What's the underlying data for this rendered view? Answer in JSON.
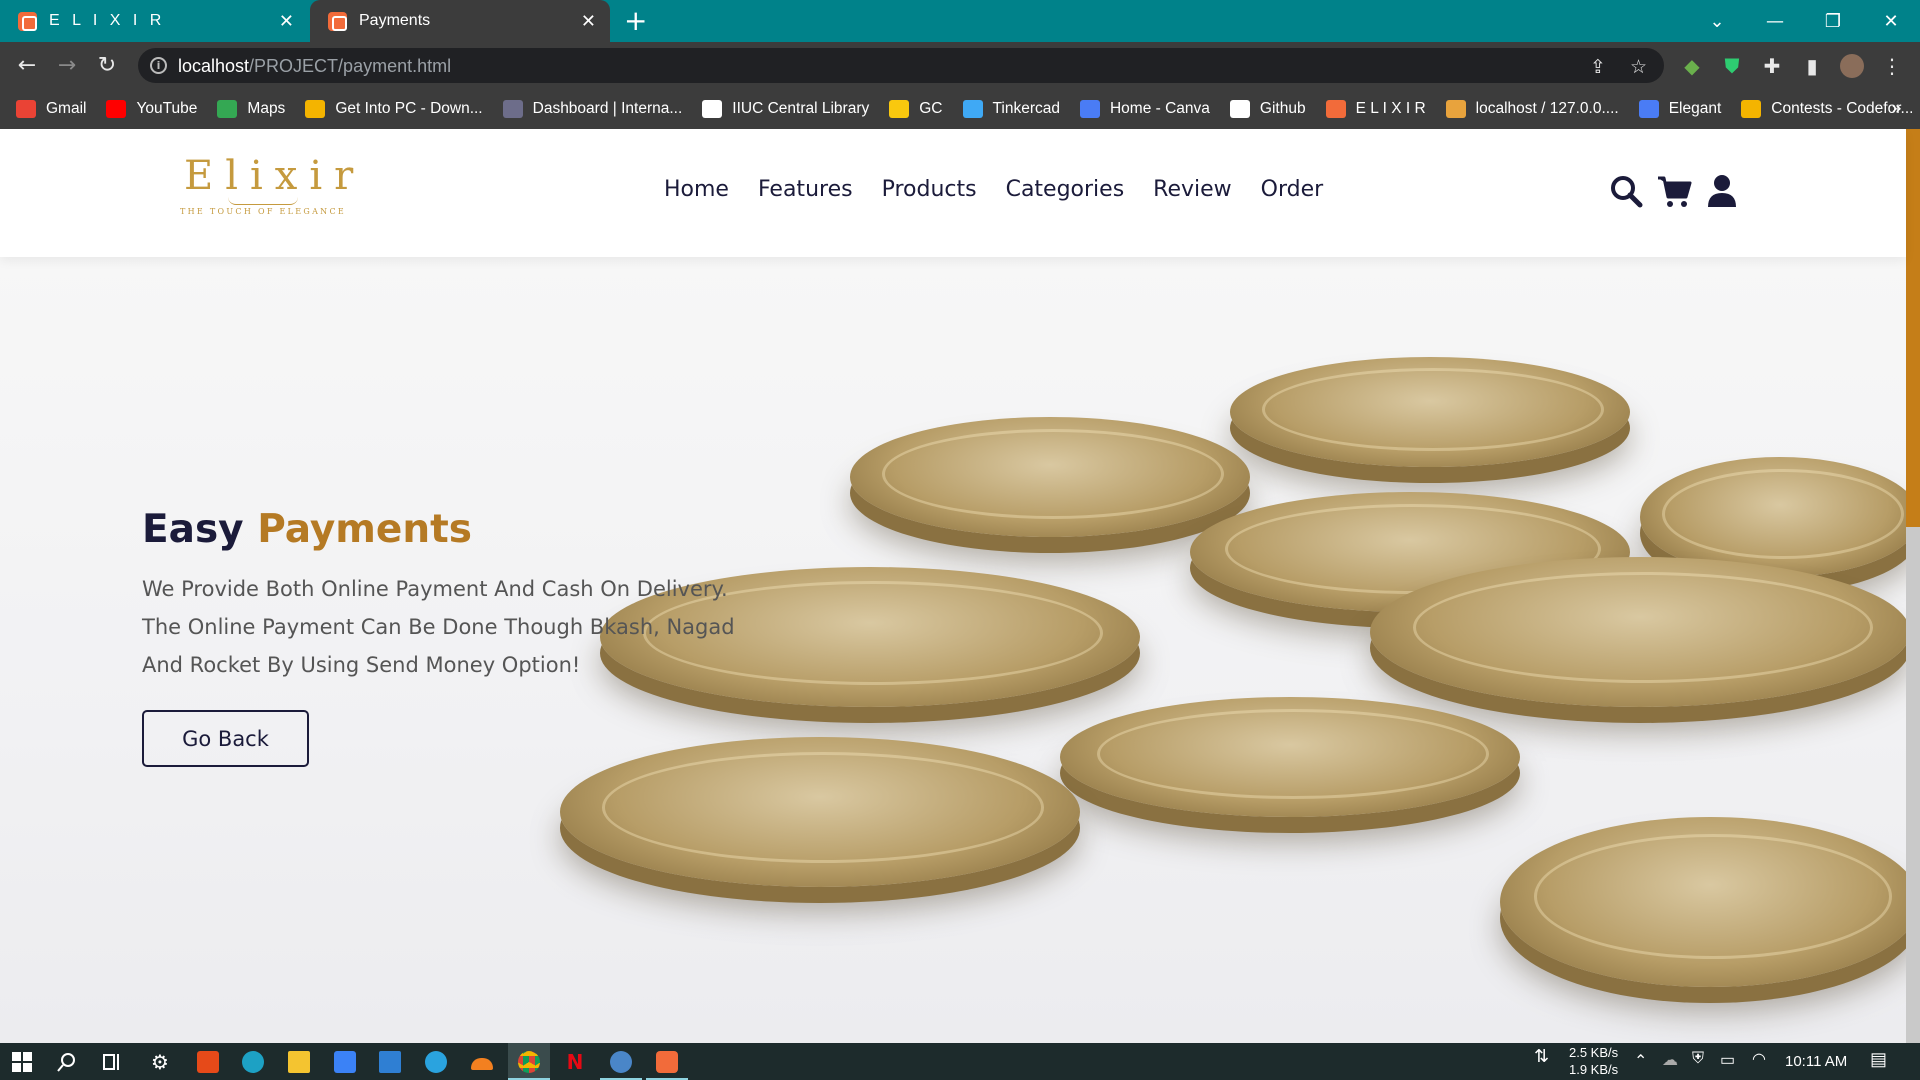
{
  "browser": {
    "tabs": [
      {
        "label": "E L I X I R",
        "close": "✕"
      },
      {
        "label": "Payments",
        "close": "✕"
      }
    ],
    "new_tab": "+",
    "window_controls": {
      "menu": "⌄",
      "minimize": "—",
      "restore": "❐",
      "close": "✕"
    },
    "url_host": "localhost",
    "url_path": "/PROJECT/payment.html",
    "bookmarks": [
      {
        "label": "Gmail",
        "icon": "gmail-icon",
        "color": "#ea4335"
      },
      {
        "label": "YouTube",
        "icon": "youtube-icon",
        "color": "#ff0000"
      },
      {
        "label": "Maps",
        "icon": "maps-icon",
        "color": "#34a853"
      },
      {
        "label": "Get Into PC - Down...",
        "icon": "getintopc-icon",
        "color": "#f4b400"
      },
      {
        "label": "Dashboard | Interna...",
        "icon": "dashboard-icon",
        "color": "#6d6d8a"
      },
      {
        "label": "IIUC Central Library",
        "icon": "library-icon",
        "color": "#ffffff"
      },
      {
        "label": "GC",
        "icon": "classroom-icon",
        "color": "#f9c80e"
      },
      {
        "label": "Tinkercad",
        "icon": "tinkercad-icon",
        "color": "#3fa9f5"
      },
      {
        "label": "Home - Canva",
        "icon": "canva-icon",
        "color": "#4a7cf5"
      },
      {
        "label": "Github",
        "icon": "github-icon",
        "color": "#ffffff"
      },
      {
        "label": "E L I X I R",
        "icon": "elixir-icon",
        "color": "#f26b3a"
      },
      {
        "label": "localhost / 127.0.0....",
        "icon": "phpmyadmin-icon",
        "color": "#e8a33d"
      },
      {
        "label": "Elegant",
        "icon": "elegant-icon",
        "color": "#4a7cf5"
      },
      {
        "label": "Contests - Codefor...",
        "icon": "codeforces-icon",
        "color": "#f4b400"
      }
    ],
    "bookmarks_more": "»"
  },
  "site": {
    "logo_text": "Elixir",
    "logo_tagline": "THE TOUCH OF ELEGANCE",
    "nav": [
      "Home",
      "Features",
      "Products",
      "Categories",
      "Review",
      "Order"
    ],
    "icons": [
      "search-icon",
      "cart-icon",
      "user-icon"
    ],
    "colors": {
      "accent": "#b57a24",
      "dark": "#1b1b3a",
      "scroll_thumb": "#c57e18"
    }
  },
  "hero": {
    "title_part1": "Easy",
    "title_part2": "Payments",
    "description_lines": [
      "We Provide Both Online Payment And Cash On Delivery.",
      "The Online Payment Can Be Done Though Bkash, Nagad",
      "And Rocket By Using Send Money Option!"
    ],
    "button_label": "Go Back"
  },
  "taskbar": {
    "net_down": "2.5 KB/s",
    "net_up": "1.9 KB/s",
    "time": "10:11 AM"
  }
}
